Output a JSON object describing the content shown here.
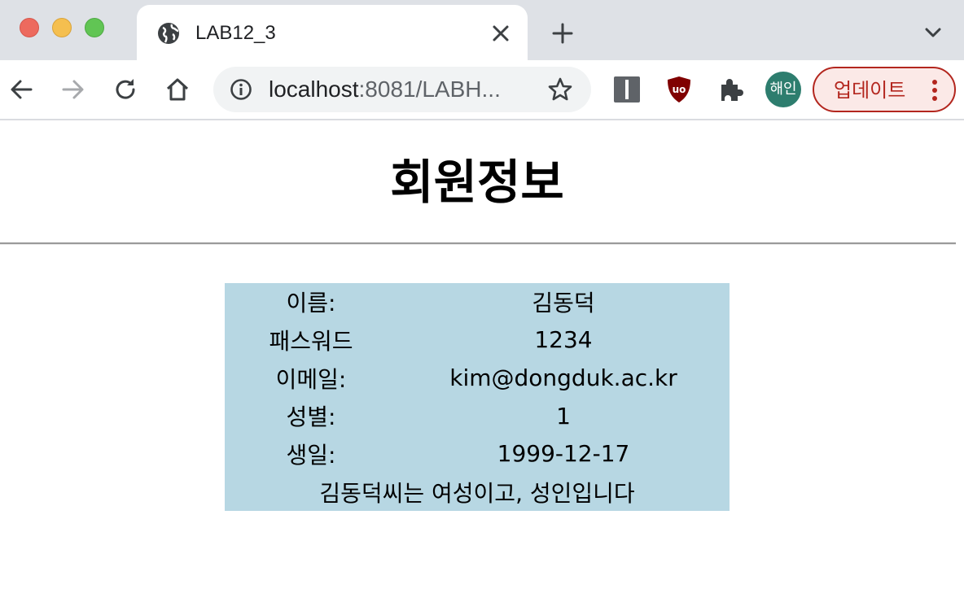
{
  "browser": {
    "tab_title": "LAB12_3",
    "url_host": "localhost",
    "url_rest": ":8081/LABH...",
    "avatar_label": "해인",
    "update_label": "업데이트",
    "colors": {
      "tabstrip_bg": "#dee1e6",
      "update_accent": "#b3261e",
      "avatar_bg": "#2d7d6e"
    },
    "icons": [
      "globe-icon",
      "close-icon",
      "plus-icon",
      "chevron-down-icon",
      "back-arrow-icon",
      "forward-arrow-icon",
      "reload-icon",
      "home-icon",
      "info-icon",
      "star-icon",
      "reader-extension-icon",
      "ublock-icon",
      "puzzle-icon",
      "kebab-menu-icon"
    ]
  },
  "page": {
    "title": "회원정보",
    "rows": [
      {
        "label": "이름:",
        "value": "김동덕"
      },
      {
        "label": "패스워드",
        "value": "1234"
      },
      {
        "label": "이메일:",
        "value": "kim@dongduk.ac.kr"
      },
      {
        "label": "성별:",
        "value": "1"
      },
      {
        "label": "생일:",
        "value": "1999-12-17"
      }
    ],
    "summary": "김동덕씨는 여성이고, 성인입니다",
    "table_bg": "#b7d7e3"
  }
}
